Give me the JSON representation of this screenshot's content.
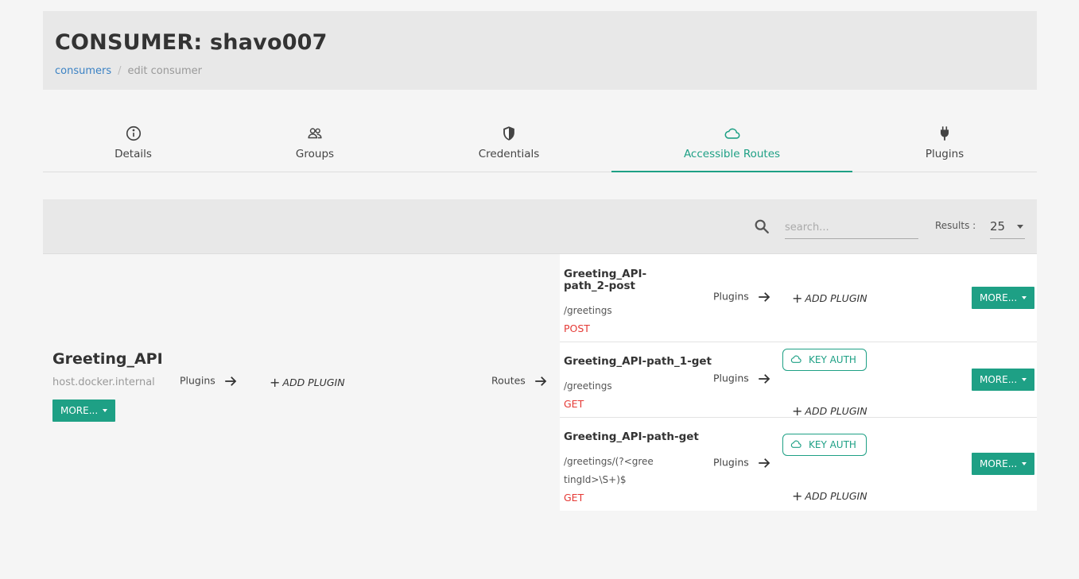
{
  "header": {
    "title": "CONSUMER: shavo007",
    "breadcrumb": {
      "link": "consumers",
      "separator": "/",
      "current": "edit consumer"
    }
  },
  "tabs": [
    {
      "label": "Details",
      "icon": "info-icon"
    },
    {
      "label": "Groups",
      "icon": "users-icon"
    },
    {
      "label": "Credentials",
      "icon": "shield-icon"
    },
    {
      "label": "Accessible Routes",
      "icon": "cloud-icon",
      "active": true
    },
    {
      "label": "Plugins",
      "icon": "plug-icon"
    }
  ],
  "toolbar": {
    "search_placeholder": "search...",
    "results_label": "Results :",
    "results_value": "25"
  },
  "service": {
    "name": "Greeting_API",
    "host": "host.docker.internal",
    "plugins_label": "Plugins",
    "add_plugin_label": "ADD PLUGIN",
    "more_label": "MORE...",
    "routes_label": "Routes"
  },
  "routes": [
    {
      "name": "Greeting_API-path_2-post",
      "path": "/greetings",
      "method": "POST",
      "plugins_label": "Plugins",
      "plugins": [],
      "add_plugin_label": "ADD PLUGIN",
      "more_label": "MORE..."
    },
    {
      "name": "Greeting_API-path_1-get",
      "path": "/greetings",
      "method": "GET",
      "plugins_label": "Plugins",
      "plugins": [
        "KEY AUTH"
      ],
      "add_plugin_label": "ADD PLUGIN",
      "more_label": "MORE..."
    },
    {
      "name": "Greeting_API-path-get",
      "path": "/greetings/(?<greetingId>\\S+)$",
      "method": "GET",
      "plugins_label": "Plugins",
      "plugins": [
        "KEY AUTH"
      ],
      "add_plugin_label": "ADD PLUGIN",
      "more_label": "MORE..."
    }
  ],
  "colors": {
    "accent": "#1ea085",
    "method": "#e53935",
    "link": "#3b82c4"
  }
}
